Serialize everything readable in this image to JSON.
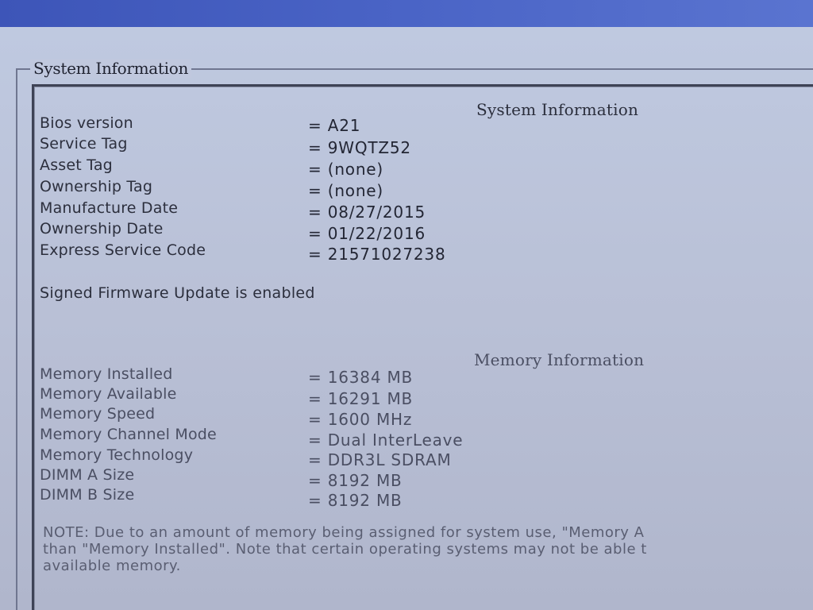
{
  "group": {
    "legend": "System Information"
  },
  "system": {
    "heading": "System Information",
    "rows": [
      {
        "label": "Bios version",
        "value": "= A21"
      },
      {
        "label": "Service Tag",
        "value": "= 9WQTZ52"
      },
      {
        "label": "Asset Tag",
        "value": "= (none)"
      },
      {
        "label": "Ownership Tag",
        "value": "= (none)"
      },
      {
        "label": "Manufacture Date",
        "value": "= 08/27/2015"
      },
      {
        "label": "Ownership Date",
        "value": "= 01/22/2016"
      },
      {
        "label": "Express Service Code",
        "value": "= 21571027238"
      }
    ],
    "status": "Signed Firmware Update is enabled"
  },
  "memory": {
    "heading": "Memory Information",
    "rows": [
      {
        "label": "Memory Installed",
        "value": "= 16384 MB"
      },
      {
        "label": "Memory Available",
        "value": "= 16291 MB"
      },
      {
        "label": "Memory Speed",
        "value": "= 1600 MHz"
      },
      {
        "label": "Memory Channel Mode",
        "value": "= Dual InterLeave"
      },
      {
        "label": "Memory Technology",
        "value": "= DDR3L SDRAM"
      },
      {
        "label": "DIMM A Size",
        "value": "= 8192 MB"
      },
      {
        "label": "DIMM B Size",
        "value": "= 8192 MB"
      }
    ]
  },
  "note": {
    "lines": [
      "NOTE: Due to an amount of memory being assigned for system use, \"Memory A",
      "than \"Memory Installed\". Note that certain operating systems may not be able t",
      "available memory."
    ]
  }
}
